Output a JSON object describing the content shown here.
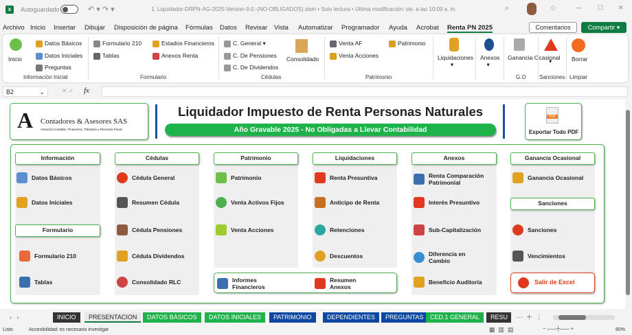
{
  "titlebar": {
    "autosave": "Autoguardado",
    "filename": "1. Liquidador-DRPN-AG-2025-Version-9.0.-(NO-OBLIGADOS).xlsm • Solo lectura • Última modificación: vie. a las 10:09 a. m."
  },
  "menu": [
    "Archivo",
    "Inicio",
    "Insertar",
    "Dibujar",
    "Disposición de página",
    "Fórmulas",
    "Datos",
    "Revisar",
    "Vista",
    "Automatizar",
    "Programador",
    "Ayuda",
    "Acrobat",
    "Renta PN 2025"
  ],
  "comments": "Comentarios",
  "share": "Compartir",
  "ribbon": {
    "inicio": "Inicio",
    "datos_basicos": "Datos Básicos",
    "datos_iniciales": "Datos Iniciales",
    "preguntas": "Preguntas",
    "g1": "Información Inicial",
    "formulario210": "Formulario 210",
    "tablas": "Tablas",
    "estados": "Estados Financieros",
    "anexos_renta": "Anexos Renta",
    "g2": "Formulario",
    "c_general": "C. General",
    "c_pensiones": "C. De Pensiones",
    "c_dividendos": "C. De Dividendos",
    "consolidado": "Consolidado",
    "g3": "Cédulas",
    "venta_af": "Venta AF",
    "venta_acciones": "Venta Acciones",
    "patrimonio": "Patrimonio",
    "g4": "Patrimonio",
    "liquidaciones": "Liquidaciones",
    "anexos": "Anexos",
    "ganancia": "Ganancia Ocasional",
    "g5": "G.O",
    "g6": "Sanciones",
    "borrar": "Borrar",
    "g7": "Limpiar"
  },
  "formula": {
    "cell": "B2",
    "fx": "fx"
  },
  "header": {
    "company": "Contadores & Asesores SAS",
    "company_sub": "Asesoría Contable, Financiera, Tributaria y Revisoría Fiscal",
    "title": "Liquidador Impuesto de Renta Personas Naturales",
    "subtitle": "Año Gravable 2025 - No Obligadas a Llevar Contabilidad",
    "export": "Exportar Todo PDF"
  },
  "sections": {
    "informacion": "Información",
    "formulario": "Formulario",
    "cedulas": "Cédulas",
    "patrimonio": "Patrimonio",
    "liquidaciones": "Liquidaciones",
    "anexos": "Anexos",
    "ganancia": "Ganancia Ocasional",
    "sanciones": "Sanciones"
  },
  "items": {
    "datos_basicos": "Datos Básicos",
    "datos_iniciales": "Datos Iniciales",
    "formulario210": "Formulario 210",
    "tablas": "Tablas",
    "cedula_general": "Cédula General",
    "resumen_cedula": "Resumen Cédula",
    "cedula_pensiones": "Cédula Pensiones",
    "cedula_dividendos": "Cédula Dividendos",
    "consolidado_rlc": "Consolidado RLC",
    "patrimonio": "Patrimonio",
    "venta_activos": "Venta Activos Fijos",
    "venta_acciones": "Venta Acciones",
    "informes": "Informes Financieros",
    "resumen_anexos": "Resumen Anexos",
    "renta_presuntiva": "Renta Presuntiva",
    "anticipo": "Anticipo de Renta",
    "retenciones": "Retenciones",
    "descuentos": "Descuentos",
    "renta_comparacion": "Renta Comparación Patrimonial",
    "interes": "Interés Presuntivo",
    "subcap": "Sub-Capitalización",
    "diferencia": "Diferencia en Cambio",
    "beneficio": "Beneficio Auditoría",
    "ganancia": "Ganancia Ocasional",
    "sanciones": "Sanciones",
    "vencimientos": "Vencimientos",
    "salir": "Salir de Excel"
  },
  "tabs": [
    {
      "label": "INICIO",
      "color": "#333333"
    },
    {
      "label": "PRESENTACION",
      "color": "#e8e8e8"
    },
    {
      "label": "DATOS BÁSICOS",
      "color": "#1db34a"
    },
    {
      "label": "DATOS INICIALES",
      "color": "#1db34a"
    },
    {
      "label": "PATRIMONIO",
      "color": "#0d47a1"
    },
    {
      "label": "DEPENDIENTES",
      "color": "#0d47a1"
    },
    {
      "label": "PREGUNTAS",
      "color": "#0d47a1"
    },
    {
      "label": "CED.1 GENERAL",
      "color": "#1db34a"
    },
    {
      "label": "RESU",
      "color": "#333333"
    }
  ],
  "status": {
    "ready": "Listo",
    "accessibility": "Accesibilidad: es necesario investigar",
    "zoom": "80%"
  }
}
